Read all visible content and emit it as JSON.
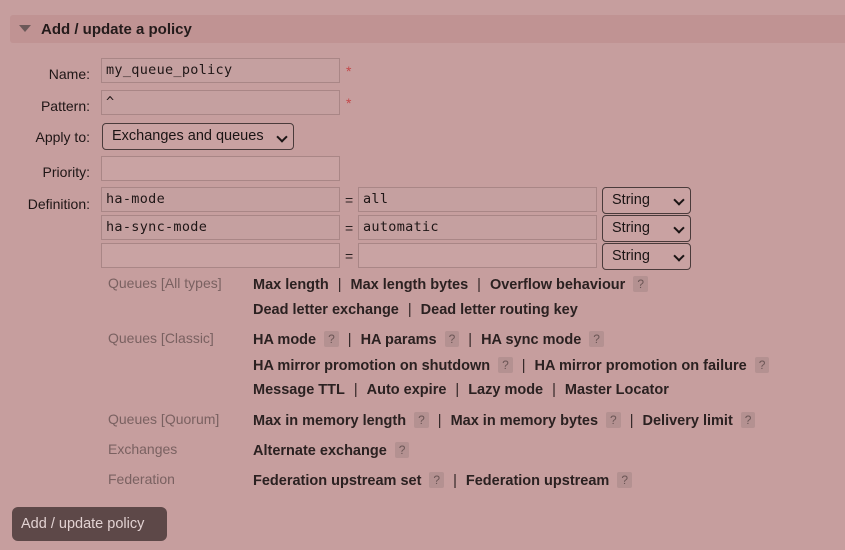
{
  "header": {
    "title": "Add / update a policy"
  },
  "form": {
    "name_label": "Name:",
    "name_value": "my_queue_policy",
    "pattern_label": "Pattern:",
    "pattern_value": "^",
    "required_mark": "*",
    "apply_label": "Apply to:",
    "apply_value": "Exchanges and queues",
    "priority_label": "Priority:",
    "priority_value": "",
    "definition_label": "Definition:",
    "eq": "=",
    "definitions": [
      {
        "key": "ha-mode",
        "value": "all",
        "type": "String"
      },
      {
        "key": "ha-sync-mode",
        "value": "automatic",
        "type": "String"
      },
      {
        "key": "",
        "value": "",
        "type": "String"
      }
    ]
  },
  "groups": {
    "queues_all": "Queues [All types]",
    "queues_classic": "Queues [Classic]",
    "queues_quorum": "Queues [Quorum]",
    "exchanges": "Exchanges",
    "federation": "Federation"
  },
  "links": {
    "max_length": "Max length",
    "max_length_bytes": "Max length bytes",
    "overflow_behaviour": "Overflow behaviour",
    "dead_letter_exchange": "Dead letter exchange",
    "dead_letter_routing_key": "Dead letter routing key",
    "ha_mode": "HA mode",
    "ha_params": "HA params",
    "ha_sync_mode": "HA sync mode",
    "ha_mirror_shutdown": "HA mirror promotion on shutdown",
    "ha_mirror_failure": "HA mirror promotion on failure",
    "message_ttl": "Message TTL",
    "auto_expire": "Auto expire",
    "lazy_mode": "Lazy mode",
    "master_locator": "Master Locator",
    "max_in_memory_length": "Max in memory length",
    "max_in_memory_bytes": "Max in memory bytes",
    "delivery_limit": "Delivery limit",
    "alternate_exchange": "Alternate exchange",
    "federation_upstream_set": "Federation upstream set",
    "federation_upstream": "Federation upstream"
  },
  "help_mark": "?",
  "separator": "|",
  "submit_label": "Add / update policy"
}
